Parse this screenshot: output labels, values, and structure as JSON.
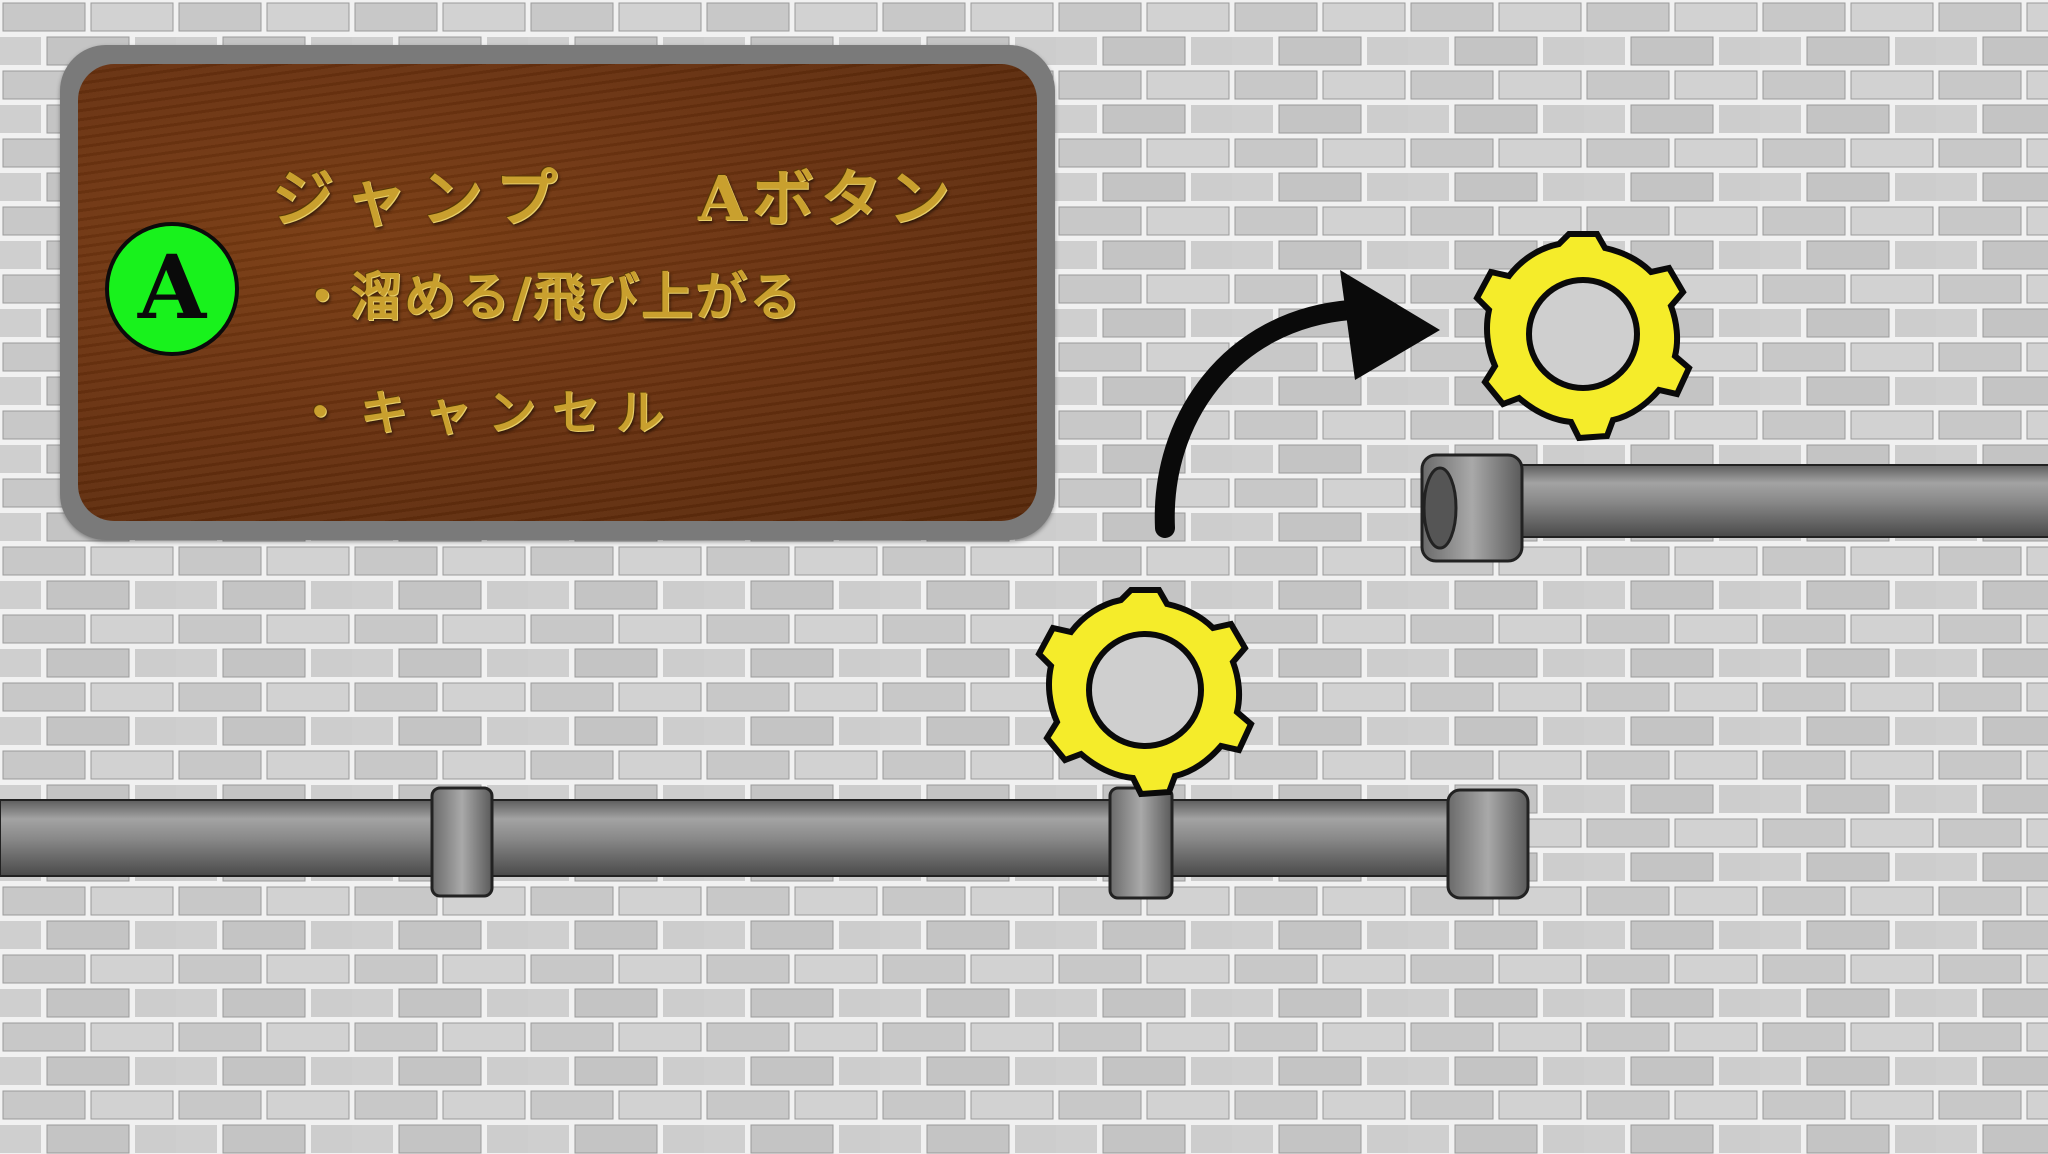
{
  "tutorial": {
    "badge_letter": "A",
    "title_action": "ジャンプ",
    "title_button": "Aボタン",
    "line1": "・溜める/飛び上がる",
    "line2": "・キャンセル"
  },
  "colors": {
    "badge_green": "#18f21c",
    "panel_brown": "#6a3210",
    "gold_text": "#c9a02e",
    "ring_yellow": "#f5ec2a",
    "pipe_gray": "#7d7d7d"
  },
  "icons": {
    "ring": "gear-ring-icon",
    "arrow": "jump-arrow-icon"
  }
}
